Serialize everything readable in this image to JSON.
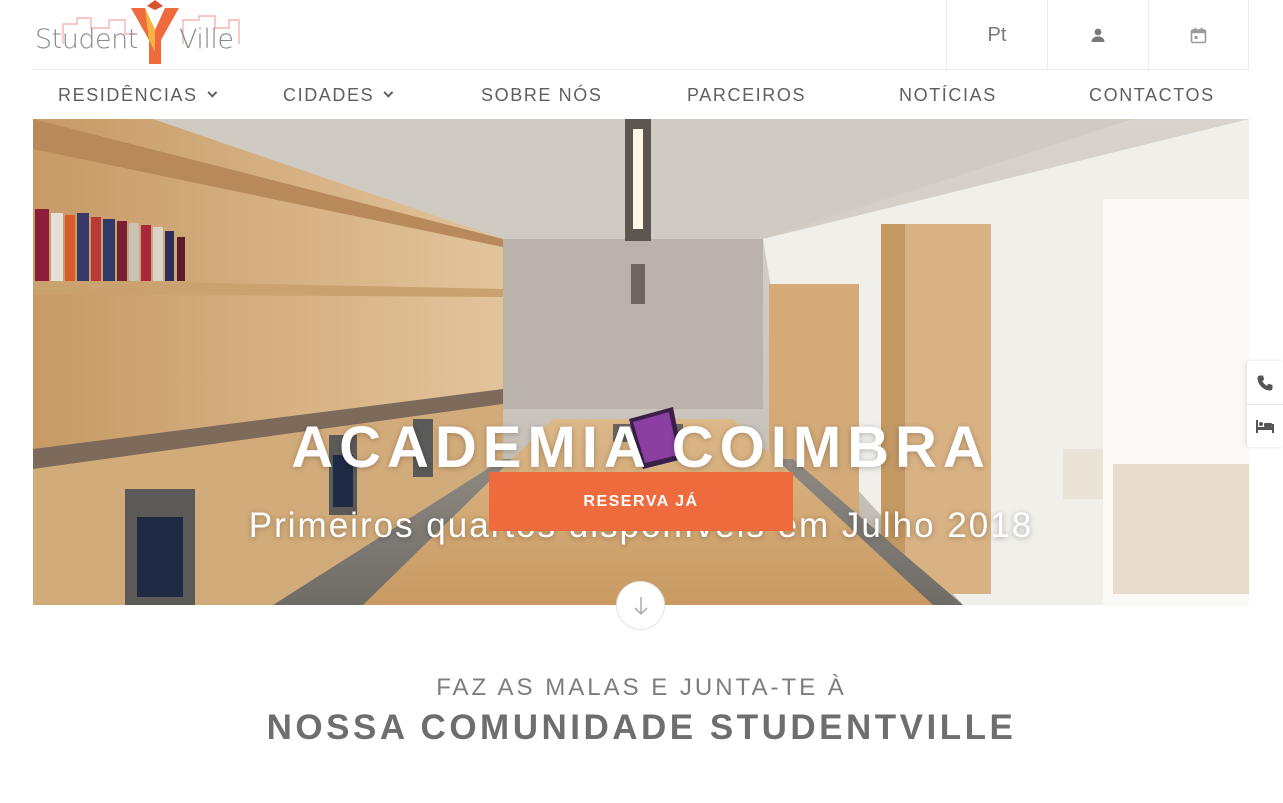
{
  "brand": {
    "logo_part1": "Student",
    "logo_part2": "Ville",
    "colors": {
      "orange": "#ef6a3c",
      "yellow": "#f6b43c"
    }
  },
  "utility": {
    "language": "Pt",
    "user_icon": "user-icon",
    "calendar_icon": "calendar-icon"
  },
  "nav": {
    "items": [
      {
        "label": "RESIDÊNCIAS",
        "has_dropdown": true
      },
      {
        "label": "CIDADES",
        "has_dropdown": true
      },
      {
        "label": "SOBRE NÓS",
        "has_dropdown": false
      },
      {
        "label": "PARCEIROS",
        "has_dropdown": false
      },
      {
        "label": "NOTÍCIAS",
        "has_dropdown": false
      },
      {
        "label": "CONTACTOS",
        "has_dropdown": false
      }
    ]
  },
  "hero": {
    "title": "ACADEMIA COIMBRA",
    "subtitle": "Primeiros quartos disponíveis em Julho 2018",
    "cta": "RESERVA JÁ",
    "cta_color": "#ef6a3c"
  },
  "side_tabs": {
    "phone_icon": "phone-icon",
    "bed_icon": "bed-icon"
  },
  "scroll": {
    "icon": "arrow-down-icon"
  },
  "community": {
    "kicker": "FAZ AS MALAS E JUNTA-TE À",
    "headline": "NOSSA COMUNIDADE STUDENTVILLE"
  }
}
